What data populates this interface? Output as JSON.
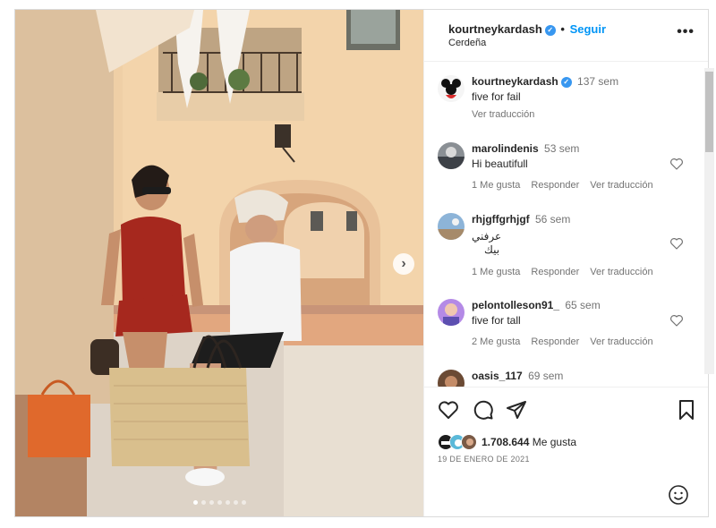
{
  "post": {
    "username": "kourtneykardash",
    "separator": "•",
    "follow_label": "Seguir",
    "location": "Cerdeña",
    "more_label": "•••",
    "next_label": "›",
    "carousel": {
      "total_slides": 7,
      "active_slide": 1
    }
  },
  "caption": {
    "username": "kourtneykardash",
    "time": "137 sem",
    "text": "five for fail",
    "translate": "Ver traducción"
  },
  "comments": [
    {
      "username": "marolindenis",
      "time": "53 sem",
      "text": "Hi beautifull",
      "likes": "1 Me gusta",
      "reply": "Responder",
      "translate": "Ver traducción"
    },
    {
      "username": "rhjgffgrhjgf",
      "time": "56 sem",
      "text": "عرفني",
      "text2": "بيك",
      "likes": "1 Me gusta",
      "reply": "Responder",
      "translate": "Ver traducción"
    },
    {
      "username": "pelontolleson91_",
      "time": "65 sem",
      "text": "five for tall",
      "likes": "2 Me gusta",
      "reply": "Responder",
      "translate": "Ver traducción"
    },
    {
      "username": "oasis_117",
      "time": "69 sem"
    }
  ],
  "footer": {
    "like_count": "1.708.644",
    "like_suffix": "Me gusta",
    "date": "19 DE ENERO DE 2021"
  },
  "colors": {
    "accent": "#0095f6",
    "verified": "#3897f0",
    "muted": "#737373",
    "text": "#262626"
  },
  "icons": [
    "verified-icon",
    "more-icon",
    "chevron-right-icon",
    "heart-icon",
    "comment-icon",
    "share-icon",
    "bookmark-icon",
    "emoji-icon"
  ]
}
